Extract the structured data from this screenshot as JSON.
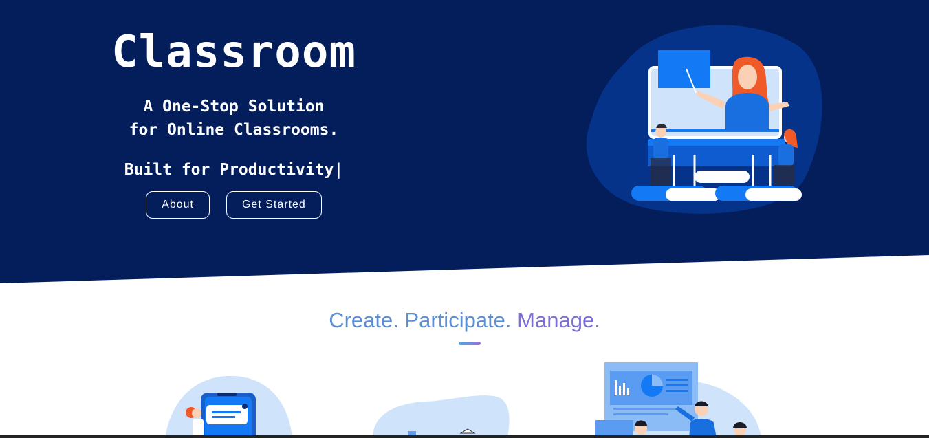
{
  "hero": {
    "title": "Classroom",
    "tagline_line1": "A One-Stop Solution",
    "tagline_line2": "for Online Classrooms.",
    "typed_text": "Built for Productivity|",
    "buttons": {
      "about": "About",
      "get_started": "Get Started"
    }
  },
  "features": {
    "heading_part1": "Create. Participate.",
    "heading_part2": "Manage."
  },
  "colors": {
    "hero_bg": "#041e5b",
    "accent_blue": "#1479f5",
    "heading_blue": "#5a8fd8",
    "heading_purple": "#7a70d8"
  },
  "icons": {
    "hero_illustration": "teacher-online-class-illustration",
    "feature_1": "mobile-chat-illustration",
    "feature_2": "reading-books-illustration",
    "feature_3": "presentation-team-illustration"
  }
}
